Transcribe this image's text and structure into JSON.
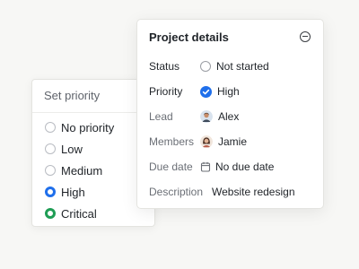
{
  "priority_menu": {
    "title": "Set priority",
    "options": [
      {
        "label": "No priority",
        "state": "default"
      },
      {
        "label": "Low",
        "state": "default"
      },
      {
        "label": "Medium",
        "state": "default"
      },
      {
        "label": "High",
        "state": "selected",
        "color": "#1f6feb"
      },
      {
        "label": "Critical",
        "state": "highlighted",
        "color": "#1f9d55"
      }
    ]
  },
  "project_details": {
    "title": "Project details",
    "collapse_icon": "minus-circle-icon",
    "rows": {
      "status": {
        "label": "Status",
        "value": "Not started",
        "icon": "empty-radio-icon"
      },
      "priority": {
        "label": "Priority",
        "value": "High",
        "icon": "check-circle-icon",
        "color": "#1f6feb"
      },
      "lead": {
        "label": "Lead",
        "value": "Alex",
        "icon": "avatar"
      },
      "members": {
        "label": "Members",
        "value": "Jamie",
        "icon": "avatar"
      },
      "due_date": {
        "label": "Due date",
        "value": "No due date",
        "icon": "calendar-icon"
      },
      "description": {
        "label": "Description",
        "value": "Website redesign"
      }
    }
  }
}
